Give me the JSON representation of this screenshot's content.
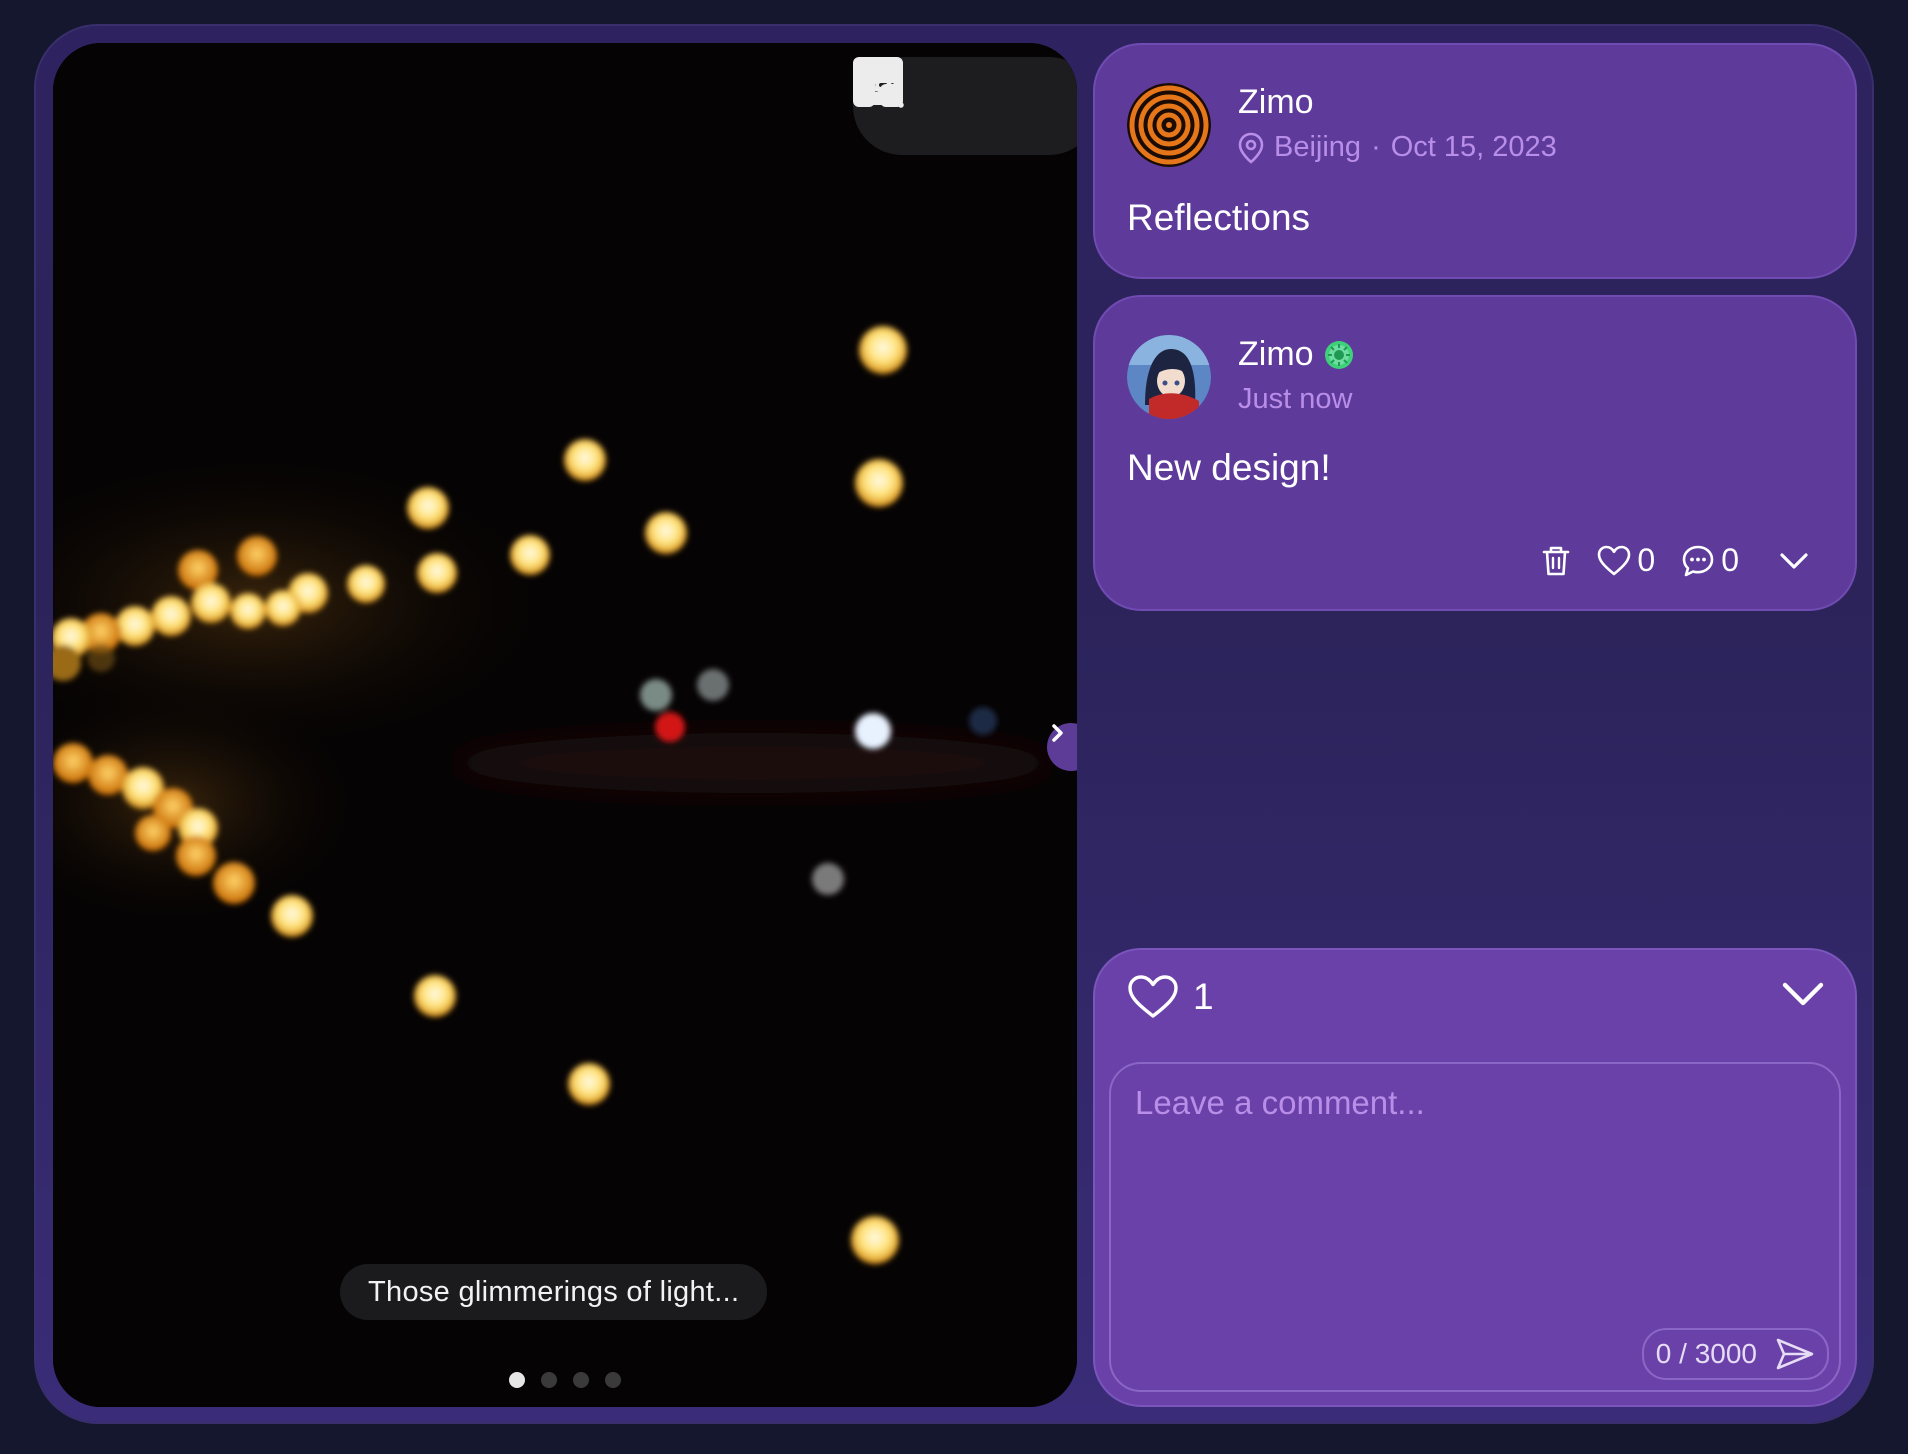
{
  "photo": {
    "caption": "Those glimmerings of light...",
    "slide_count": 4,
    "active_slide": 1,
    "toolbar": {
      "captions_icon": "captions-icon",
      "layout_icon": "layout-icon",
      "zoom_icon": "zoom-in-icon"
    }
  },
  "post": {
    "author": "Zimo",
    "location": "Beijing",
    "date": "Oct 15, 2023",
    "meta_separator": "·",
    "title": "Reflections"
  },
  "comment": {
    "author": "Zimo",
    "time": "Just now",
    "text": "New design!",
    "likes": "0",
    "replies": "0"
  },
  "comments_panel": {
    "like_count": "1",
    "placeholder": "Leave a comment...",
    "counter": "0 / 3000"
  },
  "colors": {
    "background": "#15172e",
    "card": "#5e3a9a",
    "accent_text": "#b98ee8",
    "badge": "#3fd17a"
  }
}
